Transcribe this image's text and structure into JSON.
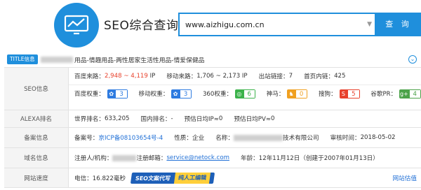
{
  "header": {
    "brand": "SEO综合查询",
    "search_value": "www.aizhigu.com.cn",
    "search_button": "查 询"
  },
  "title": {
    "badge": "TITLE信息",
    "text": "用品-情趣用品-两性居家生活性用品-情爱保健品"
  },
  "seo": {
    "label": "SEO信息",
    "baidu_traffic_label": "百度来路：",
    "baidu_traffic_value": "2,948 ~ 4,119",
    "baidu_traffic_unit": "IP",
    "mobile_traffic_label": "移动来路：",
    "mobile_traffic_value": "1,706 ~ 2,173 IP",
    "outlinks_label": "出站链接：",
    "outlinks_value": "7",
    "homepage_inlinks_label": "首页内链：",
    "homepage_inlinks_value": "425",
    "ranks": [
      {
        "label": "百度权重：",
        "value": "3",
        "icon": "paw",
        "color": "#2e7be0"
      },
      {
        "label": "移动权重：",
        "value": "3",
        "icon": "paw-mobile",
        "color": "#2e7be0"
      },
      {
        "label": "360权重：",
        "value": "6",
        "icon": "360",
        "color": "#3bb24a"
      },
      {
        "label": "神马：",
        "value": "0",
        "icon": "shenma",
        "color": "#f0a020"
      },
      {
        "label": "搜狗：",
        "value": "5",
        "icon": "sogou",
        "color": "#e8412c"
      },
      {
        "label": "谷歌PR：",
        "value": "4",
        "icon": "google-plus",
        "color": "#4ca24a"
      }
    ]
  },
  "alexa": {
    "label": "ALEXA排名",
    "world_label": "世界排名：",
    "world_value": "633,205",
    "domestic_label": "国内排名：",
    "domestic_value": "-",
    "ip_label": "预估日均IP≈",
    "ip_value": "0",
    "pv_label": "预估日均PV≈",
    "pv_value": "0"
  },
  "icp": {
    "label": "备案信息",
    "number_label": "备案号：",
    "number_value": "京ICP备08103654号-4",
    "nature_label": "性质：",
    "nature_value": "企业",
    "name_label": "名称：",
    "name_suffix": "技术有限公司",
    "audit_label": "审核时间：",
    "audit_value": "2018-05-02"
  },
  "domain": {
    "label": "域名信息",
    "registrant_label": "注册人/机构：",
    "email_label": "注册邮箱：",
    "email_value": "service@netock.com",
    "age_label": "年龄：",
    "age_value": "12年11月12日（创建于2007年01月13日）"
  },
  "speed": {
    "label": "网站速度",
    "telecom_label": "电信：",
    "telecom_value": "16.822毫秒",
    "ad_text": "SEO文案代写",
    "ad_sub": "纯人工编辑",
    "estimate_link": "网站估值"
  }
}
